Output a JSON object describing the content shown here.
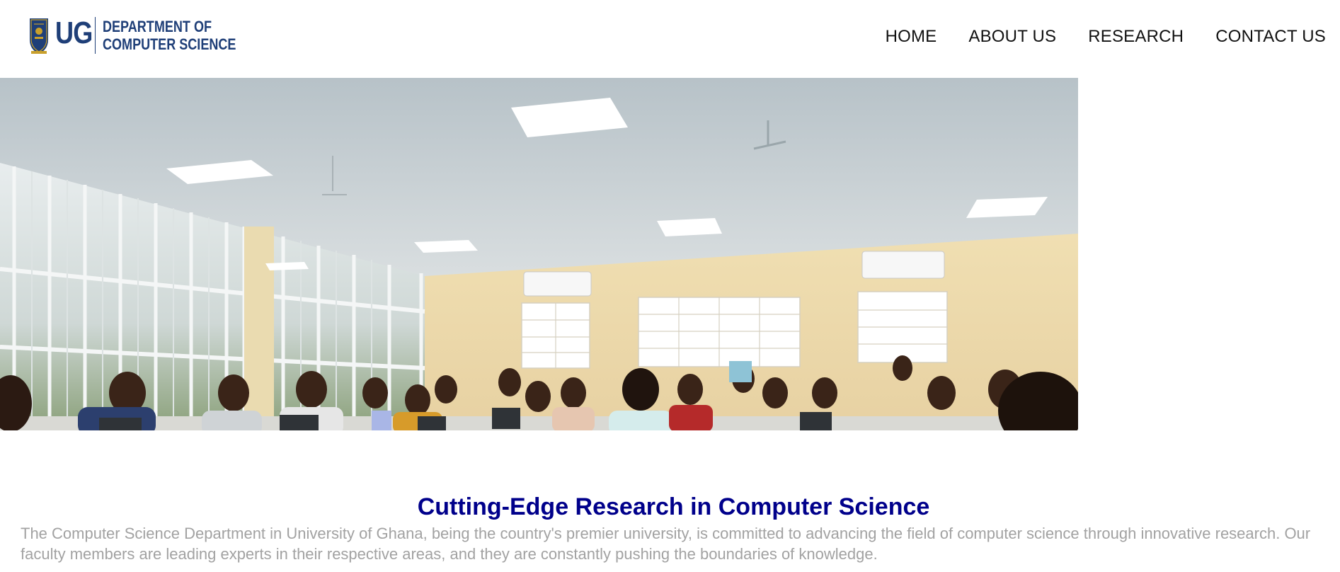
{
  "brand": {
    "logo_text": "UG",
    "dept_line1": "DEPARTMENT OF",
    "dept_line2": "COMPUTER SCIENCE",
    "colors": {
      "navy": "#1f3f78",
      "crest_gold": "#c9a02c"
    },
    "crest_icon": "university-crest-icon"
  },
  "nav": {
    "items": [
      {
        "label": "HOME"
      },
      {
        "label": "ABOUT US"
      },
      {
        "label": "RESEARCH"
      },
      {
        "label": "CONTACT US"
      }
    ]
  },
  "hero": {
    "image_subject": "students-in-computer-lab-photo"
  },
  "intro": {
    "headline": "Cutting-Edge Research in Computer Science",
    "headline_color": "#00008b",
    "body": "The Computer Science Department in University of Ghana, being the country's premier university, is committed to advancing the field of computer science through innovative research. Our faculty members are leading experts in their respective areas, and they are constantly pushing the boundaries of knowledge.",
    "body_color": "#a2a2a2"
  }
}
